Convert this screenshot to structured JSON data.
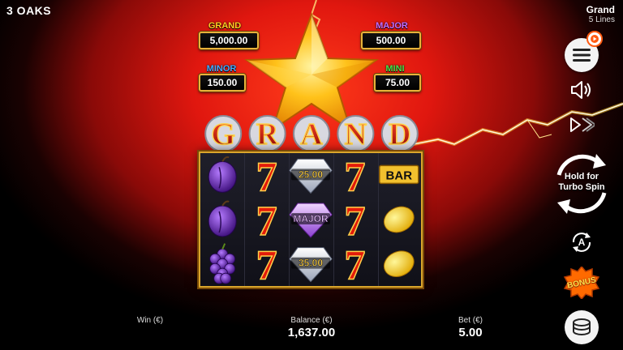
{
  "header": {
    "brand": "3 OAKS",
    "game_title": "Grand",
    "lines": "5 Lines"
  },
  "jackpots": {
    "grand": {
      "label": "GRAND",
      "value": "5,000.00"
    },
    "major": {
      "label": "MAJOR",
      "value": "500.00"
    },
    "minor": {
      "label": "MINOR",
      "value": "150.00"
    },
    "mini": {
      "label": "MINI",
      "value": "75.00"
    }
  },
  "reels_banner": "GRAND",
  "reels": {
    "columns": [
      [
        "plum",
        "plum",
        "grapes"
      ],
      [
        "seven",
        "seven",
        "seven"
      ],
      [
        "diamond",
        "diamond",
        "diamond"
      ],
      [
        "seven",
        "seven",
        "seven"
      ],
      [
        "bar",
        "lemon",
        "lemon"
      ]
    ],
    "diamond_labels": [
      "25.00",
      "MAJOR",
      "35.00"
    ],
    "bar_label": "BAR",
    "seven_label": "7"
  },
  "controls": {
    "spin_label_line1": "Hold for",
    "spin_label_line2": "Turbo Spin",
    "auto_label": "A",
    "bonus_label": "BONUS"
  },
  "footer": {
    "win_label": "Win (€)",
    "win_value": "",
    "balance_label": "Balance (€)",
    "balance_value": "1,637.00",
    "bet_label": "Bet (€)",
    "bet_value": "5.00"
  },
  "colors": {
    "accent_gold": "#e7b23a",
    "grand": "#ffcc22",
    "major": "#c36bff",
    "minor": "#3fa9ff",
    "mini": "#45e34a",
    "background_red": "#e0170f"
  }
}
